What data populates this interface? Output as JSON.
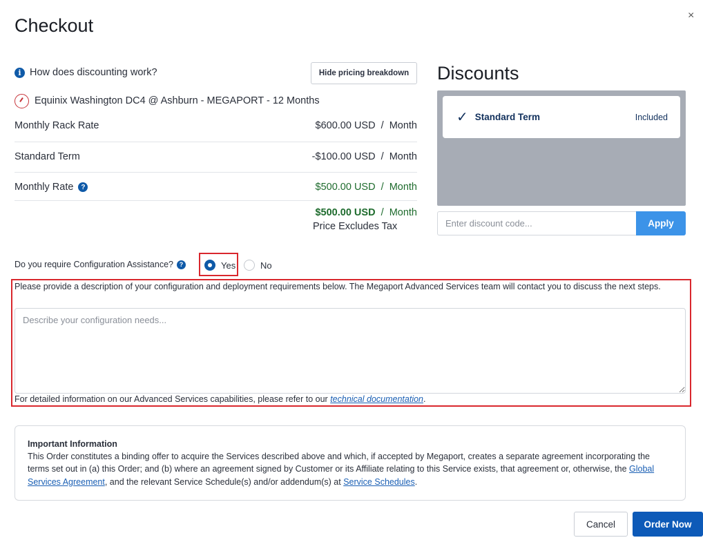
{
  "dialog": {
    "title": "Checkout",
    "close_glyph": "×"
  },
  "pricing": {
    "how_label": "How does discounting work?",
    "hide_button": "Hide pricing breakdown",
    "product": "Equinix Washington DC4 @ Ashburn - MEGAPORT - 12 Months",
    "rows": [
      {
        "label": "Monthly Rack Rate",
        "value": "$600.00 USD  /  Month"
      },
      {
        "label": "Standard Term",
        "value": "-$100.00 USD  /  Month"
      },
      {
        "label": "Monthly Rate",
        "value": "$500.00 USD  /  Month"
      }
    ],
    "total_amount": "$500.00 USD",
    "total_unit": "  /  Month",
    "tax_note": "Price Excludes Tax"
  },
  "discounts": {
    "title": "Discounts",
    "items": [
      {
        "name": "Standard Term",
        "status": "Included"
      }
    ],
    "code_placeholder": "Enter discount code...",
    "apply_label": "Apply"
  },
  "config": {
    "question": "Do you require Configuration Assistance?",
    "options": [
      "Yes",
      "No"
    ],
    "selected": "Yes",
    "description": "Please provide a description of your configuration and deployment requirements below. The Megaport Advanced Services team will contact you to discuss the next steps.",
    "placeholder": "Describe your configuration needs...",
    "footer_prefix": "For detailed information on our Advanced Services capabilities, please refer to our ",
    "footer_link": "technical documentation",
    "footer_suffix": "."
  },
  "important": {
    "title": "Important Information",
    "body_part1": "This Order constitutes a binding offer to acquire the Services described above and which, if accepted by Megaport, creates a separate agreement incorporating the terms set out in (a) this Order; and (b) where an agreement signed by Customer or its Affiliate relating to this Service exists, that agreement or, otherwise, the ",
    "link1": "Global Services Agreement",
    "body_part2": ", and the relevant Service Schedule(s) and/or addendum(s) at ",
    "link2": "Service Schedules",
    "body_part3": "."
  },
  "actions": {
    "cancel": "Cancel",
    "order": "Order Now"
  },
  "colors": {
    "primary": "#0d5ab8",
    "apply": "#3c93e8",
    "highlight": "#d9272d",
    "discount_panel": "#a7acb5",
    "positive": "#1e6b2d"
  }
}
